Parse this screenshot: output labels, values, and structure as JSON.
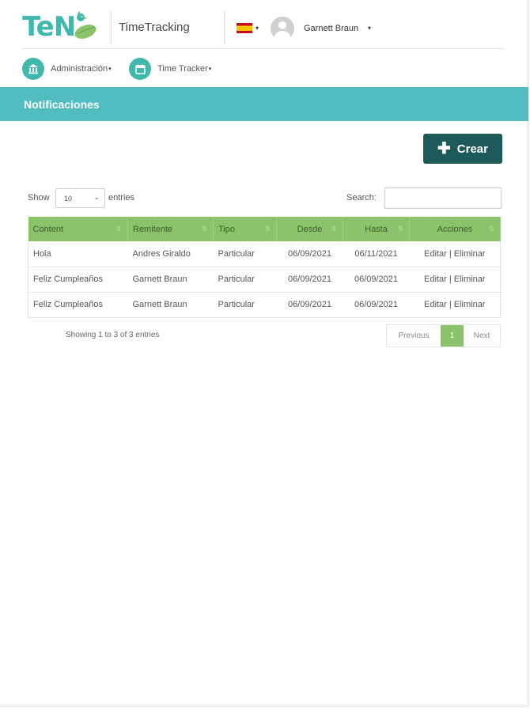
{
  "header": {
    "logo_text": "TeN",
    "app_title": "TimeTracking",
    "language_flag": "es",
    "user_name": "Garnett Braun"
  },
  "nav": {
    "items": [
      {
        "label": "Administración",
        "icon": "bank-icon"
      },
      {
        "label": "Time Tracker",
        "icon": "calendar-icon"
      }
    ]
  },
  "page": {
    "title": "Notificaciones",
    "create_label": "Crear"
  },
  "table_controls": {
    "show_label": "Show",
    "page_size": "10",
    "entries_label": "entries",
    "search_label": "Search:",
    "search_value": ""
  },
  "table": {
    "columns": [
      "Content",
      "Remitente",
      "Tipo",
      "Desde",
      "Hasta",
      "Acciones"
    ],
    "rows": [
      {
        "content": "Hola",
        "remitente": "Andres Giraldo",
        "tipo": "Particular",
        "desde": "06/09/2021",
        "hasta": "06/11/2021",
        "editar": "Editar",
        "sep": "|",
        "eliminar": "Eliminar"
      },
      {
        "content": "Feliz Cumpleaños",
        "remitente": "Garnett Braun",
        "tipo": "Particular",
        "desde": "06/09/2021",
        "hasta": "06/09/2021",
        "editar": "Editar",
        "sep": "|",
        "eliminar": "Eliminar"
      },
      {
        "content": "Feliz Cumpleaños",
        "remitente": "Garnett Braun",
        "tipo": "Particular",
        "desde": "06/09/2021",
        "hasta": "06/09/2021",
        "editar": "Editar",
        "sep": "|",
        "eliminar": "Eliminar"
      }
    ]
  },
  "footer": {
    "info": "Showing 1 to 3 of 3 entries",
    "previous": "Previous",
    "current_page": "1",
    "next": "Next"
  },
  "colors": {
    "brand_teal": "#3fb8ae",
    "banner": "#52bdc0",
    "create_button": "#1f5a5a",
    "table_header": "#8bc36a"
  }
}
